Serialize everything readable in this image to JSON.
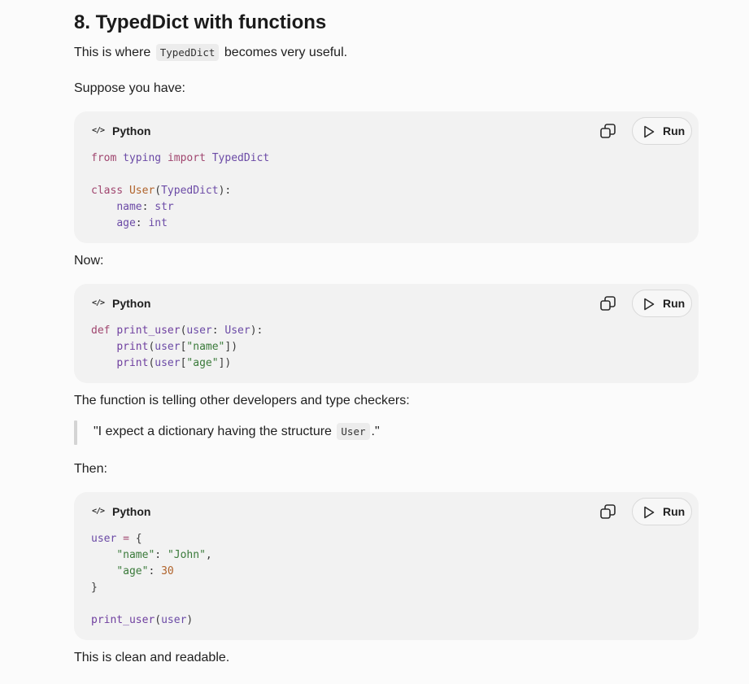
{
  "section": {
    "heading": "8. TypedDict with functions"
  },
  "intro": {
    "before": "This is where",
    "code": "TypedDict",
    "after": "becomes very useful."
  },
  "suppose_text": "Suppose you have:",
  "now_text": "Now:",
  "function_text": "The function is telling other developers and type checkers:",
  "quote": {
    "before": "\"I expect a dictionary having the structure",
    "code": "User",
    "after": ".\""
  },
  "then_text": "Then:",
  "closing_text": "This is clean and readable.",
  "code_blocks": [
    {
      "language": "Python",
      "run_label": "Run",
      "lines": [
        [
          [
            "kw",
            "from"
          ],
          [
            "pl",
            " "
          ],
          [
            "id",
            "typing"
          ],
          [
            "pl",
            " "
          ],
          [
            "kw",
            "import"
          ],
          [
            "pl",
            " "
          ],
          [
            "id",
            "TypedDict"
          ]
        ],
        [],
        [
          [
            "kw",
            "class"
          ],
          [
            "pl",
            " "
          ],
          [
            "cls",
            "User"
          ],
          [
            "pl",
            "("
          ],
          [
            "id",
            "TypedDict"
          ],
          [
            "pl",
            "):"
          ]
        ],
        [
          [
            "pl",
            "    "
          ],
          [
            "id",
            "name"
          ],
          [
            "pl",
            ": "
          ],
          [
            "id",
            "str"
          ]
        ],
        [
          [
            "pl",
            "    "
          ],
          [
            "id",
            "age"
          ],
          [
            "pl",
            ": "
          ],
          [
            "id",
            "int"
          ]
        ]
      ]
    },
    {
      "language": "Python",
      "run_label": "Run",
      "lines": [
        [
          [
            "kw",
            "def"
          ],
          [
            "pl",
            " "
          ],
          [
            "fn",
            "print_user"
          ],
          [
            "pl",
            "("
          ],
          [
            "id",
            "user"
          ],
          [
            "pl",
            ": "
          ],
          [
            "id",
            "User"
          ],
          [
            "pl",
            "):"
          ]
        ],
        [
          [
            "pl",
            "    "
          ],
          [
            "fn",
            "print"
          ],
          [
            "pl",
            "("
          ],
          [
            "id",
            "user"
          ],
          [
            "pl",
            "["
          ],
          [
            "str",
            "\"name\""
          ],
          [
            "pl",
            "])"
          ]
        ],
        [
          [
            "pl",
            "    "
          ],
          [
            "fn",
            "print"
          ],
          [
            "pl",
            "("
          ],
          [
            "id",
            "user"
          ],
          [
            "pl",
            "["
          ],
          [
            "str",
            "\"age\""
          ],
          [
            "pl",
            "])"
          ]
        ]
      ]
    },
    {
      "language": "Python",
      "run_label": "Run",
      "lines": [
        [
          [
            "id",
            "user"
          ],
          [
            "pl",
            " "
          ],
          [
            "kw",
            "="
          ],
          [
            "pl",
            " {"
          ]
        ],
        [
          [
            "pl",
            "    "
          ],
          [
            "str",
            "\"name\""
          ],
          [
            "pl",
            ": "
          ],
          [
            "str",
            "\"John\""
          ],
          [
            "pl",
            ","
          ]
        ],
        [
          [
            "pl",
            "    "
          ],
          [
            "str",
            "\"age\""
          ],
          [
            "pl",
            ": "
          ],
          [
            "num",
            "30"
          ]
        ],
        [
          [
            "pl",
            "}"
          ]
        ],
        [],
        [
          [
            "fn",
            "print_user"
          ],
          [
            "pl",
            "("
          ],
          [
            "id",
            "user"
          ],
          [
            "pl",
            ")"
          ]
        ]
      ]
    }
  ],
  "icons": {
    "language": "code-icon",
    "copy": "copy-icon",
    "run": "play-icon"
  }
}
